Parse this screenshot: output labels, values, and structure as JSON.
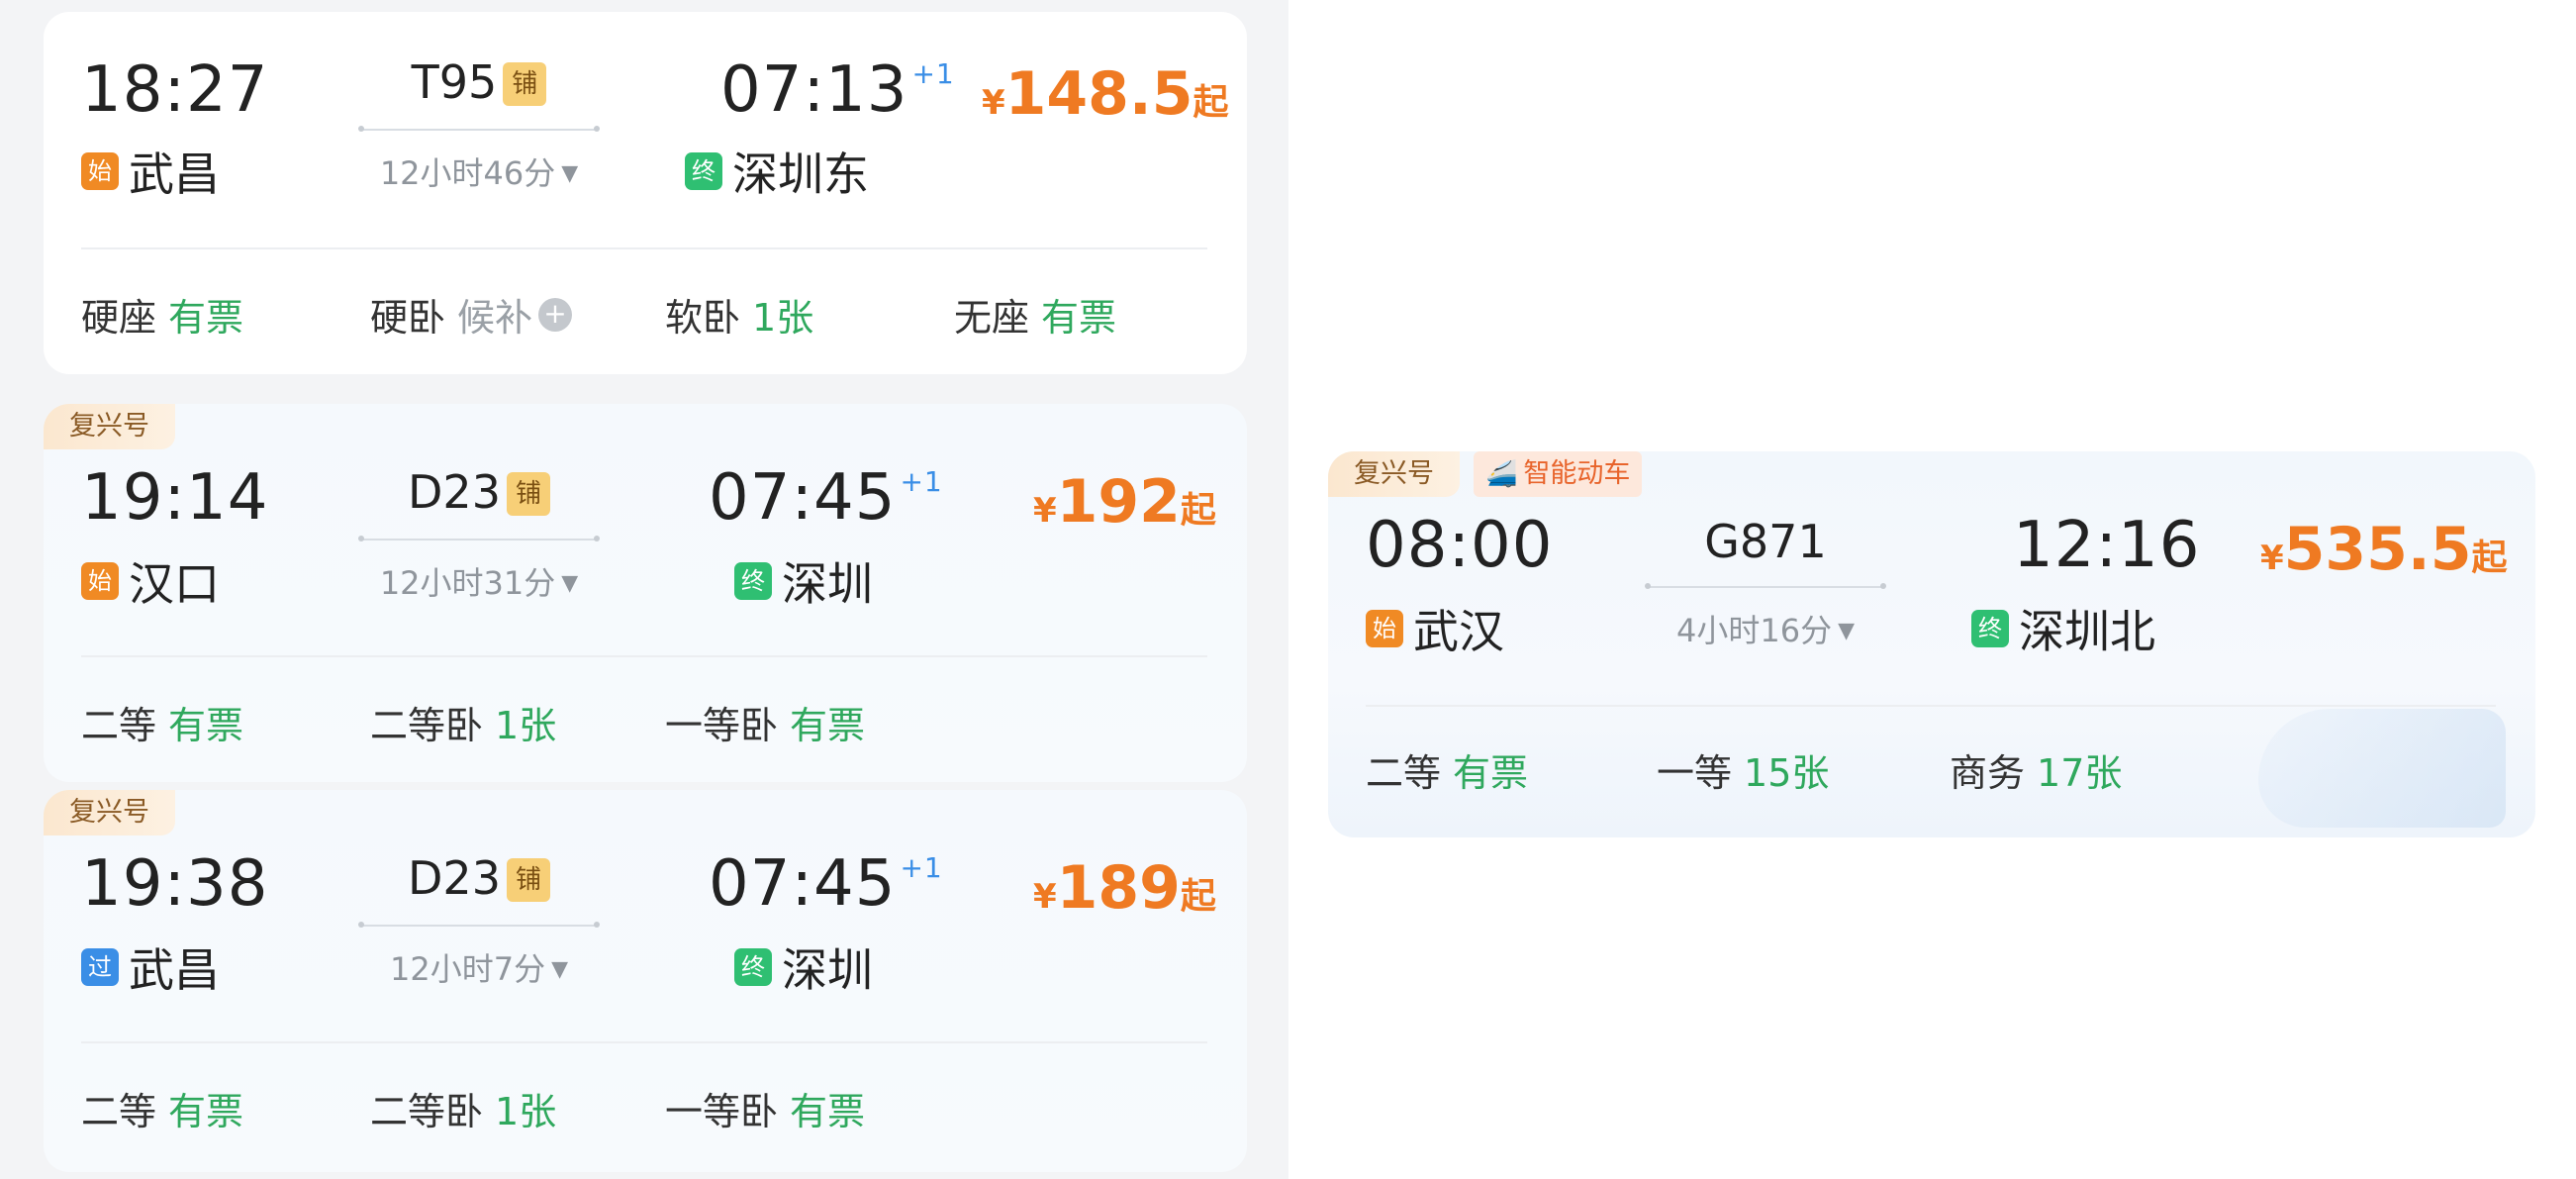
{
  "cards": [
    {
      "tags": [],
      "depart_time": "18:27",
      "depart_badge": "始",
      "depart_station": "武昌",
      "train_no": "T95",
      "bed_badge": "铺",
      "duration": "12小时46分",
      "caret": "▼",
      "arrive_time": "07:13",
      "plus_day": "+1",
      "arrive_badge": "终",
      "arrive_station": "深圳东",
      "price_symbol": "¥",
      "price": "148.5",
      "price_suffix": "起",
      "seats": [
        {
          "label": "硬座",
          "status": "有票"
        },
        {
          "label": "硬卧",
          "status": "候补",
          "add": "+"
        },
        {
          "label": "软卧",
          "status": "1张"
        },
        {
          "label": "无座",
          "status": "有票"
        }
      ]
    },
    {
      "tags": [
        "复兴号"
      ],
      "depart_time": "19:14",
      "depart_badge": "始",
      "depart_station": "汉口",
      "train_no": "D23",
      "bed_badge": "铺",
      "duration": "12小时31分",
      "caret": "▼",
      "arrive_time": "07:45",
      "plus_day": "+1",
      "arrive_badge": "终",
      "arrive_station": "深圳",
      "price_symbol": "¥",
      "price": "192",
      "price_suffix": "起",
      "seats": [
        {
          "label": "二等",
          "status": "有票"
        },
        {
          "label": "二等卧",
          "status": "1张"
        },
        {
          "label": "一等卧",
          "status": "有票"
        }
      ]
    },
    {
      "tags": [
        "复兴号"
      ],
      "depart_time": "19:38",
      "depart_badge": "过",
      "depart_station": "武昌",
      "train_no": "D23",
      "bed_badge": "铺",
      "duration": "12小时7分",
      "caret": "▼",
      "arrive_time": "07:45",
      "plus_day": "+1",
      "arrive_badge": "终",
      "arrive_station": "深圳",
      "price_symbol": "¥",
      "price": "189",
      "price_suffix": "起",
      "seats": [
        {
          "label": "二等",
          "status": "有票"
        },
        {
          "label": "二等卧",
          "status": "1张"
        },
        {
          "label": "一等卧",
          "status": "有票"
        }
      ]
    },
    {
      "tags": [
        "复兴号",
        "智能动车"
      ],
      "depart_time": "08:00",
      "depart_badge": "始",
      "depart_station": "武汉",
      "train_no": "G871",
      "duration": "4小时16分",
      "caret": "▼",
      "arrive_time": "12:16",
      "arrive_badge": "终",
      "arrive_station": "深圳北",
      "price_symbol": "¥",
      "price": "535.5",
      "price_suffix": "起",
      "seats": [
        {
          "label": "二等",
          "status": "有票"
        },
        {
          "label": "一等",
          "status": "15张"
        },
        {
          "label": "商务",
          "status": "17张"
        }
      ]
    }
  ],
  "colors": {
    "price": "#ef7a22",
    "available": "#2fa85d",
    "start_badge": "#f08a24",
    "pass_badge": "#3a8ee6",
    "end_badge": "#2fbf72",
    "plus_day": "#3a8ee6"
  },
  "icons": {
    "smart_tag": "train-front-icon",
    "waitlist_add": "plus-circle-icon",
    "duration_toggle": "caret-down-icon"
  }
}
